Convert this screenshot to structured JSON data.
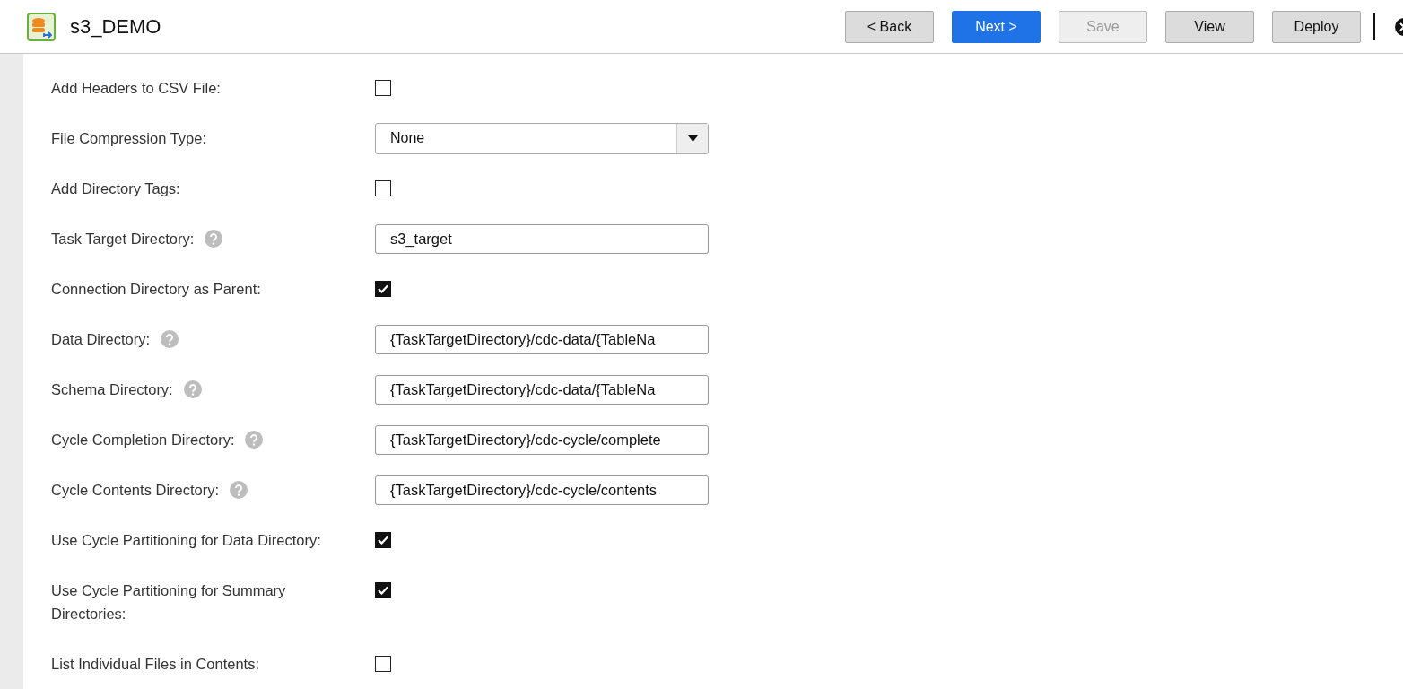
{
  "header": {
    "title": "s3_DEMO",
    "buttons": [
      {
        "label": "< Back",
        "kind": "default",
        "disabled": false
      },
      {
        "label": "Next >",
        "kind": "primary",
        "disabled": false
      },
      {
        "label": "Save",
        "kind": "default",
        "disabled": true
      },
      {
        "label": "View",
        "kind": "default",
        "disabled": false
      },
      {
        "label": "Deploy",
        "kind": "default",
        "disabled": false
      }
    ]
  },
  "form": {
    "rows": [
      {
        "label": "Add Headers to CSV File:",
        "kind": "checkbox",
        "help": false,
        "checked": false
      },
      {
        "label": "File Compression Type:",
        "kind": "select",
        "help": false,
        "value": "None"
      },
      {
        "label": "Add Directory Tags:",
        "kind": "checkbox",
        "help": false,
        "checked": false
      },
      {
        "label": "Task Target Directory:",
        "kind": "text",
        "help": true,
        "value": "s3_target"
      },
      {
        "label": "Connection Directory as Parent:",
        "kind": "checkbox",
        "help": false,
        "checked": true
      },
      {
        "label": "Data Directory:",
        "kind": "text",
        "help": true,
        "value": "{TaskTargetDirectory}/cdc-data/{TableNa"
      },
      {
        "label": "Schema Directory:",
        "kind": "text",
        "help": true,
        "value": "{TaskTargetDirectory}/cdc-data/{TableNa"
      },
      {
        "label": "Cycle Completion Directory:",
        "kind": "text",
        "help": true,
        "value": "{TaskTargetDirectory}/cdc-cycle/complete"
      },
      {
        "label": "Cycle Contents Directory:",
        "kind": "text",
        "help": true,
        "value": "{TaskTargetDirectory}/cdc-cycle/contents"
      },
      {
        "label": "Use Cycle Partitioning for Data Directory:",
        "kind": "checkbox",
        "help": false,
        "checked": true
      },
      {
        "label": "Use Cycle Partitioning for Summary Directories:",
        "kind": "checkbox",
        "help": false,
        "checked": true
      },
      {
        "label": "List Individual Files in Contents:",
        "kind": "checkbox",
        "help": false,
        "checked": false
      }
    ]
  }
}
